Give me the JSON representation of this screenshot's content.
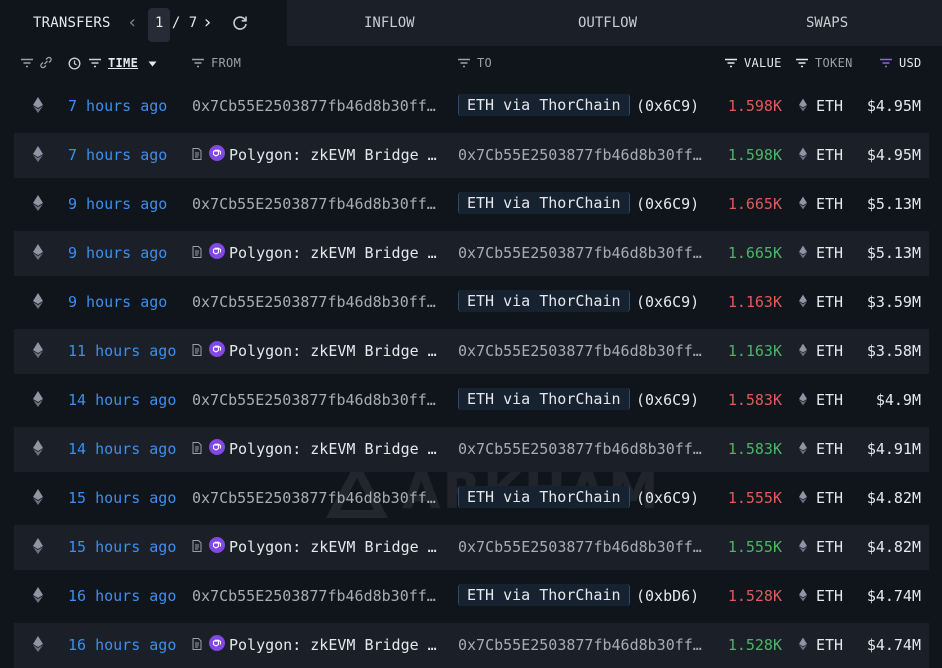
{
  "tabs": {
    "transfers": "TRANSFERS",
    "inflow": "INFLOW",
    "outflow": "OUTFLOW",
    "swaps": "SWAPS"
  },
  "pager": {
    "text": "1 / 7"
  },
  "columns": {
    "time": "TIME",
    "from": "FROM",
    "to": "TO",
    "value": "VALUE",
    "token": "TOKEN",
    "usd": "USD"
  },
  "watermark": "ARKHAM",
  "colors": {
    "accent": "#3d8ff0",
    "outflow": "#e05b5b",
    "inflow": "#4fb566",
    "polygon": "#8247e5"
  },
  "rows": [
    {
      "time": "7 hours ago",
      "from": "0x7Cb55E2503877fb46d8b30ff…",
      "to_entity": "ETH via ThorChain",
      "to_tag": "(0x6C9)",
      "value": "1.598K",
      "token": "ETH",
      "usd": "$4.95M"
    },
    {
      "time": "7 hours ago",
      "from_entity": "Polygon: zkEVM Bridge …",
      "to": "0x7Cb55E2503877fb46d8b30ff…",
      "value": "1.598K",
      "token": "ETH",
      "usd": "$4.95M"
    },
    {
      "time": "9 hours ago",
      "from": "0x7Cb55E2503877fb46d8b30ff…",
      "to_entity": "ETH via ThorChain",
      "to_tag": "(0x6C9)",
      "value": "1.665K",
      "token": "ETH",
      "usd": "$5.13M"
    },
    {
      "time": "9 hours ago",
      "from_entity": "Polygon: zkEVM Bridge …",
      "to": "0x7Cb55E2503877fb46d8b30ff…",
      "value": "1.665K",
      "token": "ETH",
      "usd": "$5.13M"
    },
    {
      "time": "9 hours ago",
      "from": "0x7Cb55E2503877fb46d8b30ff…",
      "to_entity": "ETH via ThorChain",
      "to_tag": "(0x6C9)",
      "value": "1.163K",
      "token": "ETH",
      "usd": "$3.59M"
    },
    {
      "time": "11 hours ago",
      "from_entity": "Polygon: zkEVM Bridge …",
      "to": "0x7Cb55E2503877fb46d8b30ff…",
      "value": "1.163K",
      "token": "ETH",
      "usd": "$3.58M"
    },
    {
      "time": "14 hours ago",
      "from": "0x7Cb55E2503877fb46d8b30ff…",
      "to_entity": "ETH via ThorChain",
      "to_tag": "(0x6C9)",
      "value": "1.583K",
      "token": "ETH",
      "usd": "$4.9M"
    },
    {
      "time": "14 hours ago",
      "from_entity": "Polygon: zkEVM Bridge …",
      "to": "0x7Cb55E2503877fb46d8b30ff…",
      "value": "1.583K",
      "token": "ETH",
      "usd": "$4.91M"
    },
    {
      "time": "15 hours ago",
      "from": "0x7Cb55E2503877fb46d8b30ff…",
      "to_entity": "ETH via ThorChain",
      "to_tag": "(0x6C9)",
      "value": "1.555K",
      "token": "ETH",
      "usd": "$4.82M"
    },
    {
      "time": "15 hours ago",
      "from_entity": "Polygon: zkEVM Bridge …",
      "to": "0x7Cb55E2503877fb46d8b30ff…",
      "value": "1.555K",
      "token": "ETH",
      "usd": "$4.82M"
    },
    {
      "time": "16 hours ago",
      "from": "0x7Cb55E2503877fb46d8b30ff…",
      "to_entity": "ETH via ThorChain",
      "to_tag": "(0xbD6)",
      "value": "1.528K",
      "token": "ETH",
      "usd": "$4.74M"
    },
    {
      "time": "16 hours ago",
      "from_entity": "Polygon: zkEVM Bridge …",
      "to": "0x7Cb55E2503877fb46d8b30ff…",
      "value": "1.528K",
      "token": "ETH",
      "usd": "$4.74M"
    }
  ]
}
